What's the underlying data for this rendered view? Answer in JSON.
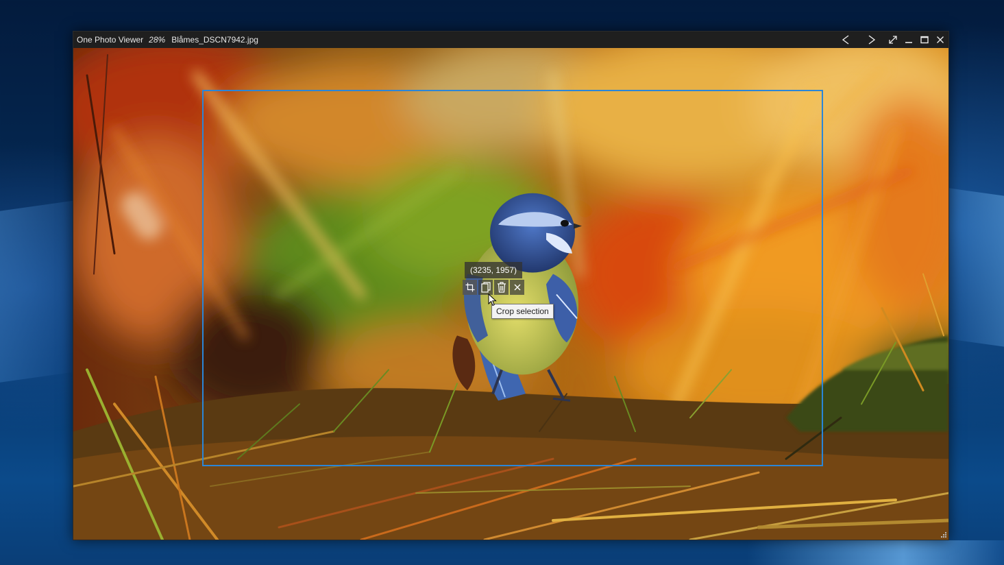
{
  "window": {
    "app_name": "One Photo Viewer",
    "zoom": "28%",
    "filename": "Blåmes_DSCN7942.jpg"
  },
  "controls": {
    "previous": "previous-icon",
    "next": "next-icon",
    "fullscreen": "fullscreen-icon",
    "minimize": "minimize-icon",
    "maximize": "maximize-icon",
    "close": "close-icon"
  },
  "selection": {
    "coords": "(3235, 1957)",
    "tooltip": "Crop selection",
    "buttons": [
      "crop-icon",
      "copy-icon",
      "delete-icon",
      "close-icon"
    ],
    "border_color": "#2a86d8"
  },
  "colors": {
    "titlebar": "#1f1f1f",
    "accent": "#2a86d8"
  }
}
